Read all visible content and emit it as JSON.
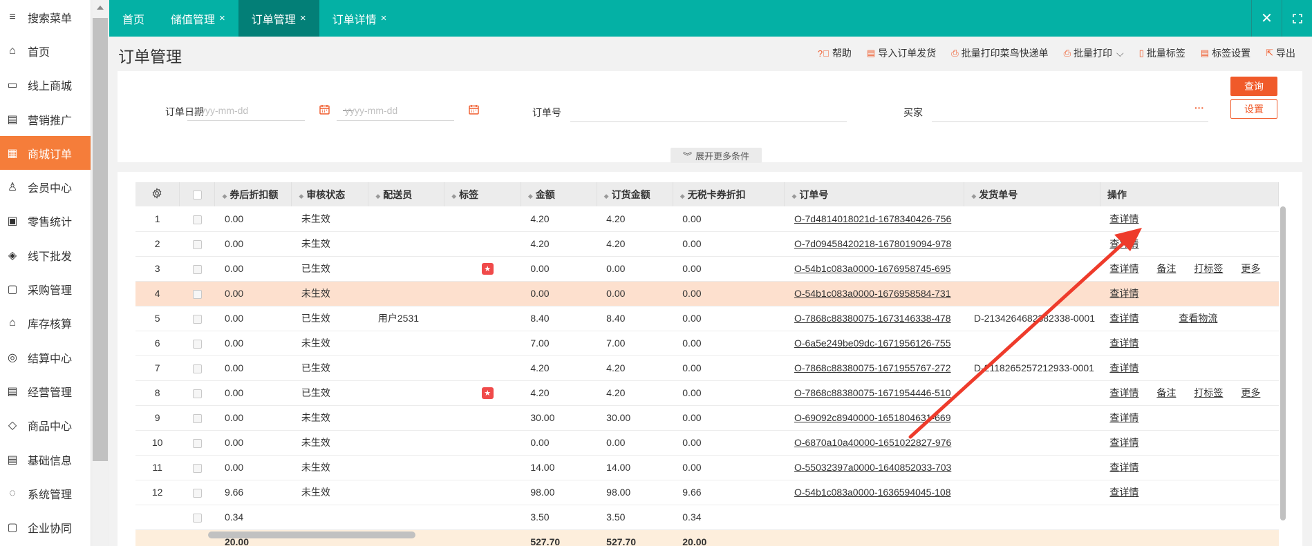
{
  "sidebar": {
    "items": [
      {
        "label": "搜索菜单",
        "icon": "search-menu-icon"
      },
      {
        "label": "首页",
        "icon": "home-icon"
      },
      {
        "label": "线上商城",
        "icon": "store-icon"
      },
      {
        "label": "营销推广",
        "icon": "marketing-icon"
      },
      {
        "label": "商城订单",
        "icon": "order-icon",
        "active": true
      },
      {
        "label": "会员中心",
        "icon": "member-icon"
      },
      {
        "label": "零售统计",
        "icon": "stats-icon"
      },
      {
        "label": "线下批发",
        "icon": "wholesale-icon"
      },
      {
        "label": "采购管理",
        "icon": "purchase-icon"
      },
      {
        "label": "库存核算",
        "icon": "warehouse-icon"
      },
      {
        "label": "结算中心",
        "icon": "settlement-icon"
      },
      {
        "label": "经营管理",
        "icon": "management-icon"
      },
      {
        "label": "商品中心",
        "icon": "product-icon"
      },
      {
        "label": "基础信息",
        "icon": "info-icon"
      },
      {
        "label": "系统管理",
        "icon": "system-icon"
      },
      {
        "label": "企业协同",
        "icon": "collab-icon"
      }
    ]
  },
  "tabs": [
    {
      "label": "首页",
      "closable": false
    },
    {
      "label": "储值管理",
      "closable": true
    },
    {
      "label": "订单管理",
      "closable": true,
      "active": true
    },
    {
      "label": "订单详情",
      "closable": true
    }
  ],
  "page": {
    "title": "订单管理"
  },
  "toolbar": {
    "help": "帮助",
    "import": "导入订单发货",
    "batch_print_cainiao": "批量打印菜鸟快递单",
    "batch_print": "批量打印",
    "batch_tag": "批量标签",
    "tag_settings": "标签设置",
    "export": "导出"
  },
  "filter": {
    "order_date_label": "订单日期",
    "date_placeholder": "yyyy-mm-dd",
    "date_sep": "—",
    "order_no_label": "订单号",
    "buyer_label": "买家",
    "buyer_more": "···",
    "query_button": "查询",
    "settings_button": "设置",
    "expand_label": "展开更多条件"
  },
  "table": {
    "columns": [
      "",
      "",
      "券后折扣额",
      "审核状态",
      "配送员",
      "标签",
      "金额",
      "订货金额",
      "无税卡券折扣",
      "订单号",
      "发货单号",
      "操作"
    ],
    "rows": [
      {
        "idx": "1",
        "coupon": "0.00",
        "status": "未生效",
        "courier": "",
        "tag": false,
        "amount": "4.20",
        "order_amount": "4.20",
        "taxfree": "0.00",
        "order_no": "O-7d4814018021d-1678340426-756",
        "ship_no": "",
        "ops": [
          "查详情"
        ]
      },
      {
        "idx": "2",
        "coupon": "0.00",
        "status": "未生效",
        "courier": "",
        "tag": false,
        "amount": "4.20",
        "order_amount": "4.20",
        "taxfree": "0.00",
        "order_no": "O-7d09458420218-1678019094-978",
        "ship_no": "",
        "ops": [
          "查详情"
        ]
      },
      {
        "idx": "3",
        "coupon": "0.00",
        "status": "已生效",
        "courier": "",
        "tag": true,
        "amount": "0.00",
        "order_amount": "0.00",
        "taxfree": "0.00",
        "order_no": "O-54b1c083a0000-1676958745-695",
        "ship_no": "",
        "ops": [
          "查详情",
          "备注",
          "打标签",
          "更多"
        ]
      },
      {
        "idx": "4",
        "coupon": "0.00",
        "status": "未生效",
        "courier": "",
        "tag": false,
        "amount": "0.00",
        "order_amount": "0.00",
        "taxfree": "0.00",
        "order_no": "O-54b1c083a0000-1676958584-731",
        "ship_no": "",
        "ops": [
          "查详情"
        ],
        "highlight": true
      },
      {
        "idx": "5",
        "coupon": "0.00",
        "status": "已生效",
        "courier": "用户2531",
        "tag": false,
        "amount": "8.40",
        "order_amount": "8.40",
        "taxfree": "0.00",
        "order_no": "O-7868c88380075-1673146338-478",
        "ship_no": "D-2134264682382338-0001",
        "ops": [
          "查详情",
          "查看物流"
        ]
      },
      {
        "idx": "6",
        "coupon": "0.00",
        "status": "未生效",
        "courier": "",
        "tag": false,
        "amount": "7.00",
        "order_amount": "7.00",
        "taxfree": "0.00",
        "order_no": "O-6a5e249be09dc-1671956126-755",
        "ship_no": "",
        "ops": [
          "查详情"
        ]
      },
      {
        "idx": "7",
        "coupon": "0.00",
        "status": "已生效",
        "courier": "",
        "tag": false,
        "amount": "4.20",
        "order_amount": "4.20",
        "taxfree": "0.00",
        "order_no": "O-7868c88380075-1671955767-272",
        "ship_no": "D-2118265257212933-0001",
        "ops": [
          "查详情"
        ]
      },
      {
        "idx": "8",
        "coupon": "0.00",
        "status": "已生效",
        "courier": "",
        "tag": true,
        "amount": "4.20",
        "order_amount": "4.20",
        "taxfree": "0.00",
        "order_no": "O-7868c88380075-1671954446-510",
        "ship_no": "",
        "ops": [
          "查详情",
          "备注",
          "打标签",
          "更多"
        ]
      },
      {
        "idx": "9",
        "coupon": "0.00",
        "status": "未生效",
        "courier": "",
        "tag": false,
        "amount": "30.00",
        "order_amount": "30.00",
        "taxfree": "0.00",
        "order_no": "O-69092c8940000-1651804631-669",
        "ship_no": "",
        "ops": [
          "查详情"
        ]
      },
      {
        "idx": "10",
        "coupon": "0.00",
        "status": "未生效",
        "courier": "",
        "tag": false,
        "amount": "0.00",
        "order_amount": "0.00",
        "taxfree": "0.00",
        "order_no": "O-6870a10a40000-1651022827-976",
        "ship_no": "",
        "ops": [
          "查详情"
        ]
      },
      {
        "idx": "11",
        "coupon": "0.00",
        "status": "未生效",
        "courier": "",
        "tag": false,
        "amount": "14.00",
        "order_amount": "14.00",
        "taxfree": "0.00",
        "order_no": "O-55032397a0000-1640852033-703",
        "ship_no": "",
        "ops": [
          "查详情"
        ]
      },
      {
        "idx": "12",
        "coupon": "9.66",
        "status": "未生效",
        "courier": "",
        "tag": false,
        "amount": "98.00",
        "order_amount": "98.00",
        "taxfree": "9.66",
        "order_no": "O-54b1c083a0000-1636594045-108",
        "ship_no": "",
        "ops": [
          "查详情"
        ]
      },
      {
        "idx": "",
        "coupon": "0.34",
        "status": "",
        "courier": "",
        "tag": false,
        "amount": "3.50",
        "order_amount": "3.50",
        "taxfree": "0.34",
        "order_no": "",
        "ship_no": "",
        "ops": []
      }
    ],
    "summary": {
      "coupon": "20.00",
      "amount": "527.70",
      "order_amount": "527.70",
      "taxfree": "20.00"
    }
  },
  "colors": {
    "accent": "#f05a2a",
    "tabbar": "#04b1a5",
    "tab_active": "#037f77",
    "sidebar_active": "#f57d3a",
    "row_highlight": "#fde0ce",
    "summary_row": "#fdeedc",
    "annotation_arrow": "#ee3b2b"
  }
}
